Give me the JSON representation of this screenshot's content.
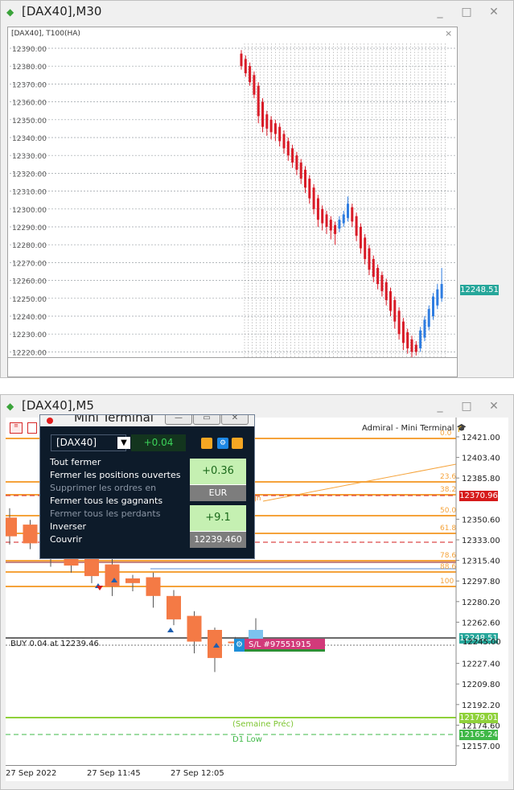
{
  "top_window": {
    "title": "[DAX40],M30",
    "panel_label": "[DAX40], T100(HA)",
    "price_tag": "12248.51",
    "y_ticks": [
      "12390.00",
      "12380.00",
      "12370.00",
      "12360.00",
      "12350.00",
      "12340.00",
      "12330.00",
      "12320.00",
      "12310.00",
      "12300.00",
      "12290.00",
      "12280.00",
      "12270.00",
      "12260.00",
      "12250.00",
      "12240.00",
      "12230.00",
      "12220.00"
    ],
    "close_glyph": "×"
  },
  "bottom_window": {
    "title": "[DAX40],M5",
    "brand": "Admiral - Mini Terminal",
    "price_axis": [
      "12421.00",
      "12403.40",
      "12385.80",
      "12350.60",
      "12333.00",
      "12315.40",
      "12297.80",
      "12280.20",
      "12262.60",
      "12227.40",
      "12209.80",
      "12192.20",
      "12174.60",
      "12157.00"
    ],
    "price_tags": [
      {
        "text": "12370.96",
        "color": "#d61b1b"
      },
      {
        "text": "12248.51",
        "color": "#26a69a"
      },
      {
        "text": "12179.01",
        "color": "#8fd13a"
      },
      {
        "text": "12165.24",
        "color": "#3fb847"
      }
    ],
    "overlap_label": "12245.00",
    "fib_levels": [
      "0.0",
      "23.6",
      "38.2",
      "50.0",
      "61.8",
      "78.6",
      "88.6",
      "100"
    ],
    "gh_label": "gh",
    "time_labels": [
      "27 Sep 2022",
      "27 Sep 11:45",
      "27 Sep 12:05"
    ],
    "buy_label": "BUY 0.04 at 12239.46",
    "sl_label": "S/L #97551915",
    "week_label": "(Semaine Préc)",
    "d1_label": "D1 Low"
  },
  "mini_terminal": {
    "title": "Mini Terminal",
    "symbol": "[DAX40]",
    "lot": "+0.04",
    "actions": [
      {
        "label": "Tout fermer",
        "enabled": true
      },
      {
        "label": "Fermer les positions ouvertes",
        "enabled": true
      },
      {
        "label": "Supprimer les ordres en",
        "enabled": false
      },
      {
        "label": "Fermer tous les gagnants",
        "enabled": true
      },
      {
        "label": "Fermer tous les perdants",
        "enabled": false
      },
      {
        "label": "Inverser",
        "enabled": true
      },
      {
        "label": "Couvrir",
        "enabled": true
      }
    ],
    "pl_value": "+0.36",
    "pl_currency": "EUR",
    "pips_value": "+9.1",
    "price_value": "12239.460"
  },
  "colors": {
    "bear_candle": "#d81b27",
    "bull_candle": "#2f7de1",
    "fib_orange": "#f5a33b",
    "bear_m5": "#f47a45",
    "bull_m5": "#7cc3ef"
  },
  "candles_m30": [
    {
      "o": 12387,
      "c": 12380,
      "h": 12389,
      "l": 12378
    },
    {
      "o": 12384,
      "c": 12376,
      "h": 12386,
      "l": 12374
    },
    {
      "o": 12380,
      "c": 12371,
      "h": 12382,
      "l": 12369
    },
    {
      "o": 12375,
      "c": 12364,
      "h": 12377,
      "l": 12362
    },
    {
      "o": 12369,
      "c": 12352,
      "h": 12371,
      "l": 12348
    },
    {
      "o": 12360,
      "c": 12346,
      "h": 12362,
      "l": 12343
    },
    {
      "o": 12353,
      "c": 12345,
      "h": 12355,
      "l": 12341
    },
    {
      "o": 12350,
      "c": 12343,
      "h": 12352,
      "l": 12339
    },
    {
      "o": 12348,
      "c": 12342,
      "h": 12350,
      "l": 12338
    },
    {
      "o": 12346,
      "c": 12338,
      "h": 12348,
      "l": 12335
    },
    {
      "o": 12342,
      "c": 12334,
      "h": 12344,
      "l": 12331
    },
    {
      "o": 12338,
      "c": 12330,
      "h": 12340,
      "l": 12327
    },
    {
      "o": 12334,
      "c": 12326,
      "h": 12336,
      "l": 12323
    },
    {
      "o": 12330,
      "c": 12322,
      "h": 12332,
      "l": 12319
    },
    {
      "o": 12326,
      "c": 12317,
      "h": 12328,
      "l": 12314
    },
    {
      "o": 12322,
      "c": 12312,
      "h": 12324,
      "l": 12309
    },
    {
      "o": 12317,
      "c": 12306,
      "h": 12319,
      "l": 12303
    },
    {
      "o": 12312,
      "c": 12300,
      "h": 12314,
      "l": 12297
    },
    {
      "o": 12306,
      "c": 12294,
      "h": 12308,
      "l": 12290
    },
    {
      "o": 12300,
      "c": 12292,
      "h": 12302,
      "l": 12288
    },
    {
      "o": 12297,
      "c": 12290,
      "h": 12299,
      "l": 12286
    },
    {
      "o": 12294,
      "c": 12288,
      "h": 12296,
      "l": 12283
    },
    {
      "o": 12291,
      "c": 12286,
      "h": 12293,
      "l": 12280
    },
    {
      "o": 12289,
      "c": 12294,
      "h": 12296,
      "l": 12287
    },
    {
      "o": 12292,
      "c": 12297,
      "h": 12299,
      "l": 12290
    },
    {
      "o": 12295,
      "c": 12303,
      "h": 12307,
      "l": 12293
    },
    {
      "o": 12301,
      "c": 12293,
      "h": 12303,
      "l": 12290
    },
    {
      "o": 12296,
      "c": 12285,
      "h": 12298,
      "l": 12282
    },
    {
      "o": 12290,
      "c": 12278,
      "h": 12292,
      "l": 12275
    },
    {
      "o": 12284,
      "c": 12272,
      "h": 12286,
      "l": 12269
    },
    {
      "o": 12278,
      "c": 12266,
      "h": 12280,
      "l": 12263
    },
    {
      "o": 12272,
      "c": 12262,
      "h": 12274,
      "l": 12259
    },
    {
      "o": 12267,
      "c": 12258,
      "h": 12269,
      "l": 12255
    },
    {
      "o": 12263,
      "c": 12254,
      "h": 12265,
      "l": 12251
    },
    {
      "o": 12259,
      "c": 12249,
      "h": 12261,
      "l": 12246
    },
    {
      "o": 12254,
      "c": 12243,
      "h": 12256,
      "l": 12240
    },
    {
      "o": 12249,
      "c": 12237,
      "h": 12251,
      "l": 12233
    },
    {
      "o": 12243,
      "c": 12230,
      "h": 12245,
      "l": 12227
    },
    {
      "o": 12237,
      "c": 12225,
      "h": 12239,
      "l": 12221
    },
    {
      "o": 12231,
      "c": 12222,
      "h": 12233,
      "l": 12219
    },
    {
      "o": 12227,
      "c": 12220,
      "h": 12229,
      "l": 12217
    },
    {
      "o": 12224,
      "c": 12220,
      "h": 12226,
      "l": 12218
    },
    {
      "o": 12222,
      "c": 12232,
      "h": 12234,
      "l": 12220
    },
    {
      "o": 12228,
      "c": 12238,
      "h": 12240,
      "l": 12226
    },
    {
      "o": 12234,
      "c": 12244,
      "h": 12246,
      "l": 12232
    },
    {
      "o": 12240,
      "c": 12251,
      "h": 12253,
      "l": 12238
    },
    {
      "o": 12246,
      "c": 12255,
      "h": 12258,
      "l": 12244
    },
    {
      "o": 12250,
      "c": 12258,
      "h": 12267,
      "l": 12248
    }
  ],
  "candles_m5": [
    {
      "o": 12352,
      "c": 12336,
      "h": 12360,
      "l": 12329
    },
    {
      "o": 12346,
      "c": 12330,
      "h": 12350,
      "l": 12325
    },
    {
      "o": 12334,
      "c": 12320,
      "h": 12338,
      "l": 12310
    },
    {
      "o": 12326,
      "c": 12311,
      "h": 12330,
      "l": 12305
    },
    {
      "o": 12318,
      "c": 12302,
      "h": 12322,
      "l": 12296
    },
    {
      "o": 12312,
      "c": 12293,
      "h": 12317,
      "l": 12285
    },
    {
      "o": 12300,
      "c": 12296,
      "h": 12303,
      "l": 12289
    },
    {
      "o": 12301,
      "c": 12285,
      "h": 12305,
      "l": 12275
    },
    {
      "o": 12285,
      "c": 12265,
      "h": 12290,
      "l": 12260
    },
    {
      "o": 12268,
      "c": 12246,
      "h": 12272,
      "l": 12236
    },
    {
      "o": 12256,
      "c": 12232,
      "h": 12258,
      "l": 12220
    },
    {
      "o": 12246,
      "c": 12245,
      "h": 12250,
      "l": 12238
    },
    {
      "o": 12244,
      "c": 12256,
      "h": 12266,
      "l": 12240
    }
  ]
}
